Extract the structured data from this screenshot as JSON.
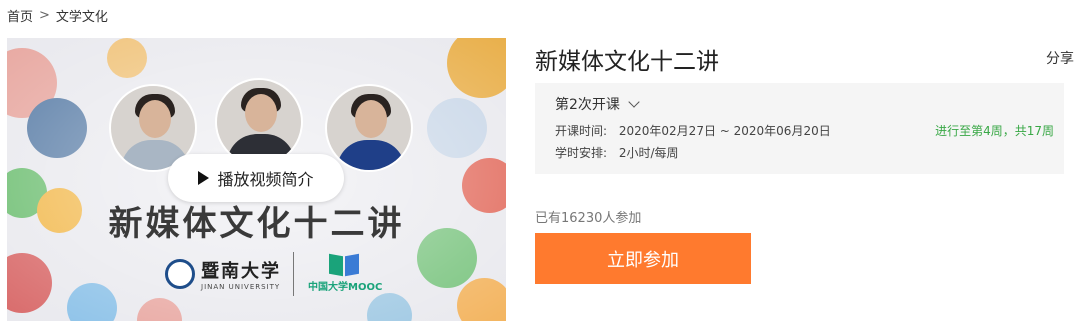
{
  "breadcrumb": {
    "home": "首页",
    "separator": ">",
    "category": "文学文化"
  },
  "video": {
    "play_label": "播放视频简介",
    "cover_title": "新媒体文化十二讲",
    "university_name": "暨南大学",
    "university_en": "JINAN UNIVERSITY",
    "platform_name": "中国大学MOOC"
  },
  "course": {
    "title": "新媒体文化十二讲",
    "share_label": "分享"
  },
  "session": {
    "label": "第2次开课",
    "time_label": "开课时间:",
    "time_value": "2020年02月27日 ~ 2020年06月20日",
    "hours_label": "学时安排:",
    "hours_value": "2小时/每周",
    "progress_text": "进行至第4周，共17周"
  },
  "enroll": {
    "count_text": "已有16230人参加",
    "button_label": "立即参加"
  },
  "colors": {
    "accent": "#ff7a2e",
    "progress": "#39a846",
    "panel": "#f5f5f5"
  }
}
